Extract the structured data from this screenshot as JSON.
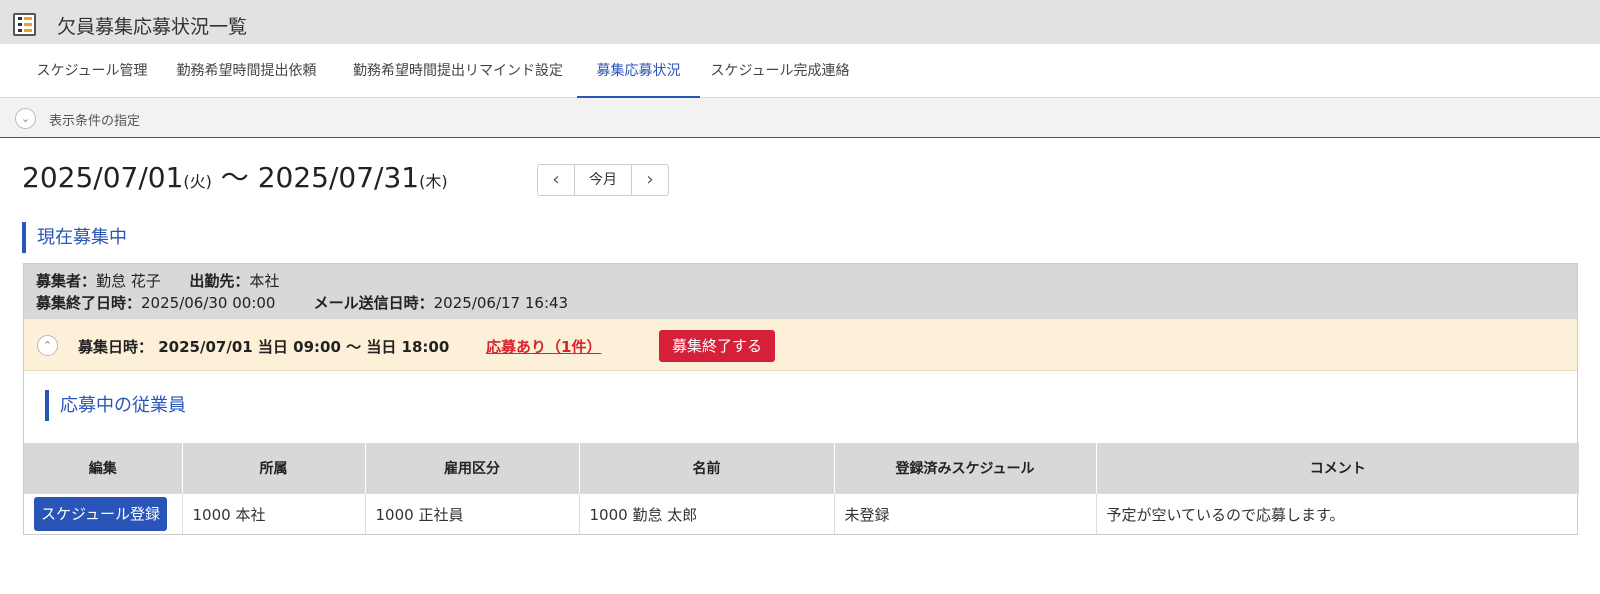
{
  "app": {
    "title": "欠員募集応募状況一覧"
  },
  "tabs": [
    {
      "label": "スケジュール管理"
    },
    {
      "label": "勤務希望時間提出依頼"
    },
    {
      "label": "勤務希望時間提出リマインド設定"
    },
    {
      "label": "募集応募状況",
      "active": true
    },
    {
      "label": "スケジュール完成連絡"
    }
  ],
  "filter": {
    "label": "表示条件の指定"
  },
  "range": {
    "start": "2025/07/01",
    "start_dow": "(火)",
    "sep": "〜",
    "end": "2025/07/31",
    "end_dow": "(木)"
  },
  "pager": {
    "prev": "‹",
    "current": "今月",
    "next": "›"
  },
  "section": {
    "title": "現在募集中"
  },
  "recruitment": {
    "recruiter_label": "募集者：",
    "recruiter": "勤怠  花子",
    "workplace_label": "出勤先：",
    "workplace": "本社",
    "end_label": "募集終了日時：",
    "end": "2025/06/30 00:00",
    "mail_label": "メール送信日時：",
    "mail": "2025/06/17 16:43",
    "date_label": "募集日時：",
    "date": "2025/07/01 当日 09:00 〜 当日 18:00",
    "applied": "応募あり（1件）",
    "end_button": "募集終了する"
  },
  "applicants": {
    "title": "応募中の従業員",
    "columns": [
      "編集",
      "所属",
      "雇用区分",
      "名前",
      "登録済みスケジュール",
      "コメント"
    ],
    "rows": [
      {
        "button": "スケジュール登録",
        "department": "1000 本社",
        "employment": "1000 正社員",
        "name": "1000 勤怠 太郎",
        "schedule": "未登録",
        "comment": "予定が空いているので応募します。"
      }
    ]
  },
  "colors": {
    "accent": "#2a55b8",
    "danger": "#d6203a",
    "highlight": "#fdf0d8"
  }
}
